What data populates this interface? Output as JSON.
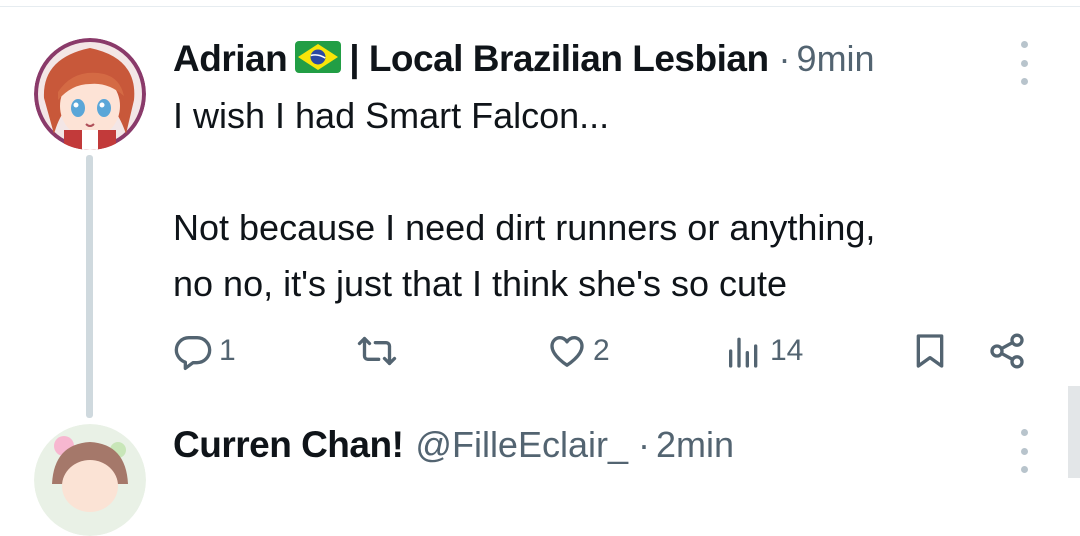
{
  "tweet": {
    "display_name": "Adrian",
    "flag_name": "brazil-flag",
    "name_suffix": "| Local Brazilian Lesbian",
    "time": "9min",
    "text": "I wish I had Smart Falcon...\n\nNot because I need dirt runners or anything,\nno no, it's just that I think she's so cute",
    "replies": "1",
    "likes": "2",
    "views": "14"
  },
  "reply_tweet": {
    "display_name": "Curren Chan!",
    "handle": "@FilleEclair_",
    "time": "2min"
  },
  "colors": {
    "text_primary": "#0f1419",
    "text_secondary": "#536471",
    "thread_line": "#cfd9de",
    "more_dots": "#b8c4cc"
  }
}
